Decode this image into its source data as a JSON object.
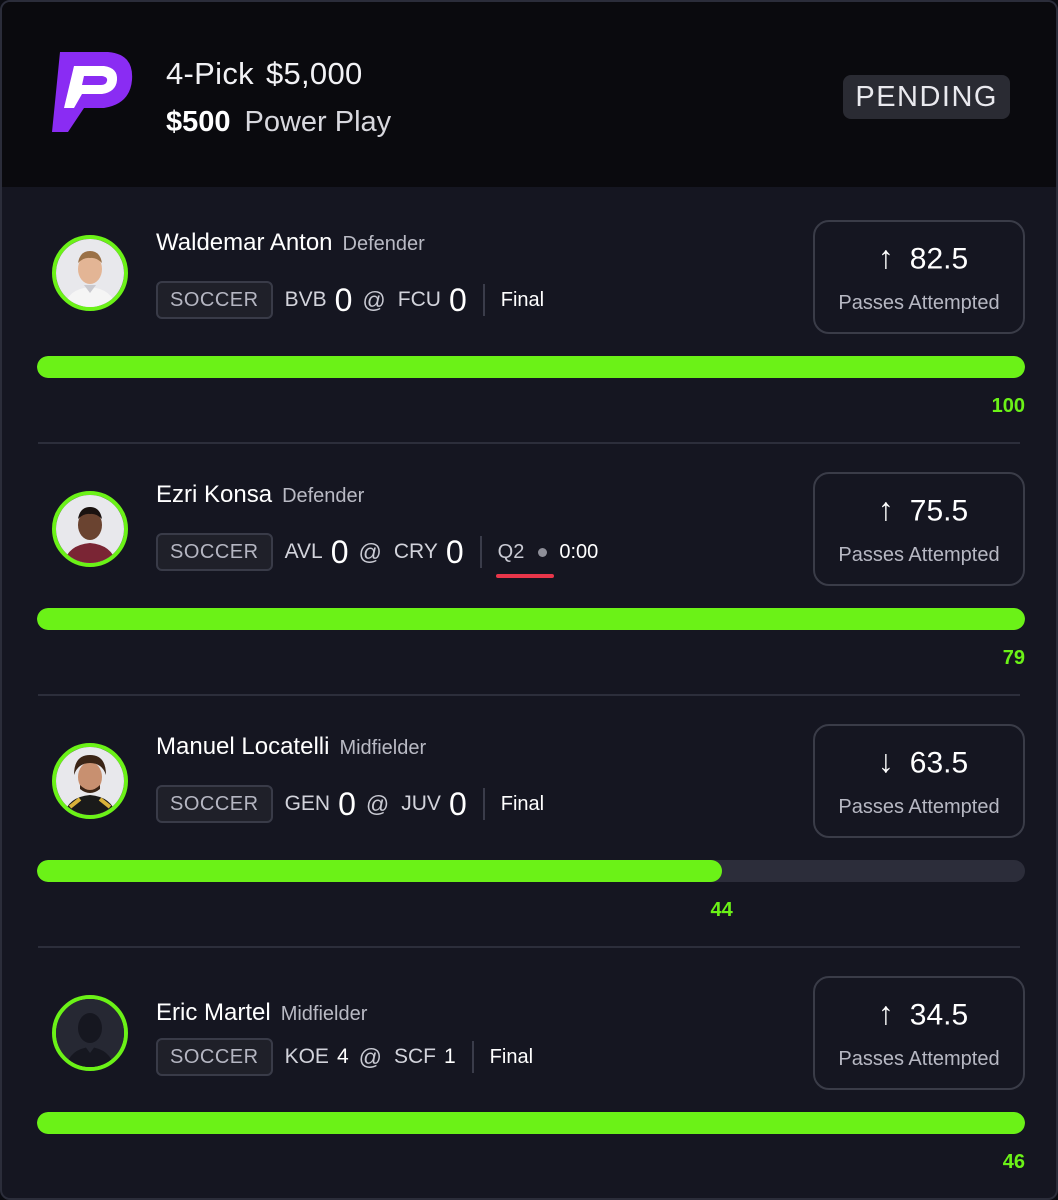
{
  "header": {
    "picks_label": "4-Pick",
    "payout": "$5,000",
    "entry_amount": "$500",
    "play_type": "Power Play",
    "status": "PENDING"
  },
  "colors": {
    "accent_green": "#6bf217",
    "live_red": "#e8364a",
    "logo_purple": "#8a2cf3"
  },
  "picks": [
    {
      "player": "Waldemar Anton",
      "position": "Defender",
      "sport": "SOCCER",
      "away_team": "BVB",
      "away_score": "0",
      "home_team": "FCU",
      "home_score": "0",
      "at": "@",
      "status": "Final",
      "direction": "up",
      "arrow": "↑",
      "line": "82.5",
      "stat": "Passes Attempted",
      "progress": 1.0,
      "progress_value": "100"
    },
    {
      "player": "Ezri Konsa",
      "position": "Defender",
      "sport": "SOCCER",
      "away_team": "AVL",
      "away_score": "0",
      "home_team": "CRY",
      "home_score": "0",
      "at": "@",
      "period": "Q2",
      "clock": "0:00",
      "direction": "up",
      "arrow": "↑",
      "line": "75.5",
      "stat": "Passes Attempted",
      "progress": 1.0,
      "progress_value": "79"
    },
    {
      "player": "Manuel Locatelli",
      "position": "Midfielder",
      "sport": "SOCCER",
      "away_team": "GEN",
      "away_score": "0",
      "home_team": "JUV",
      "home_score": "0",
      "at": "@",
      "status": "Final",
      "direction": "down",
      "arrow": "↓",
      "line": "63.5",
      "stat": "Passes Attempted",
      "progress": 0.693,
      "progress_value": "44"
    },
    {
      "player": "Eric Martel",
      "position": "Midfielder",
      "sport": "SOCCER",
      "away_team": "KOE",
      "away_score": "4",
      "home_team": "SCF",
      "home_score": "1",
      "at": "@",
      "status": "Final",
      "direction": "up",
      "arrow": "↑",
      "line": "34.5",
      "stat": "Passes Attempted",
      "progress": 1.0,
      "progress_value": "46"
    }
  ]
}
